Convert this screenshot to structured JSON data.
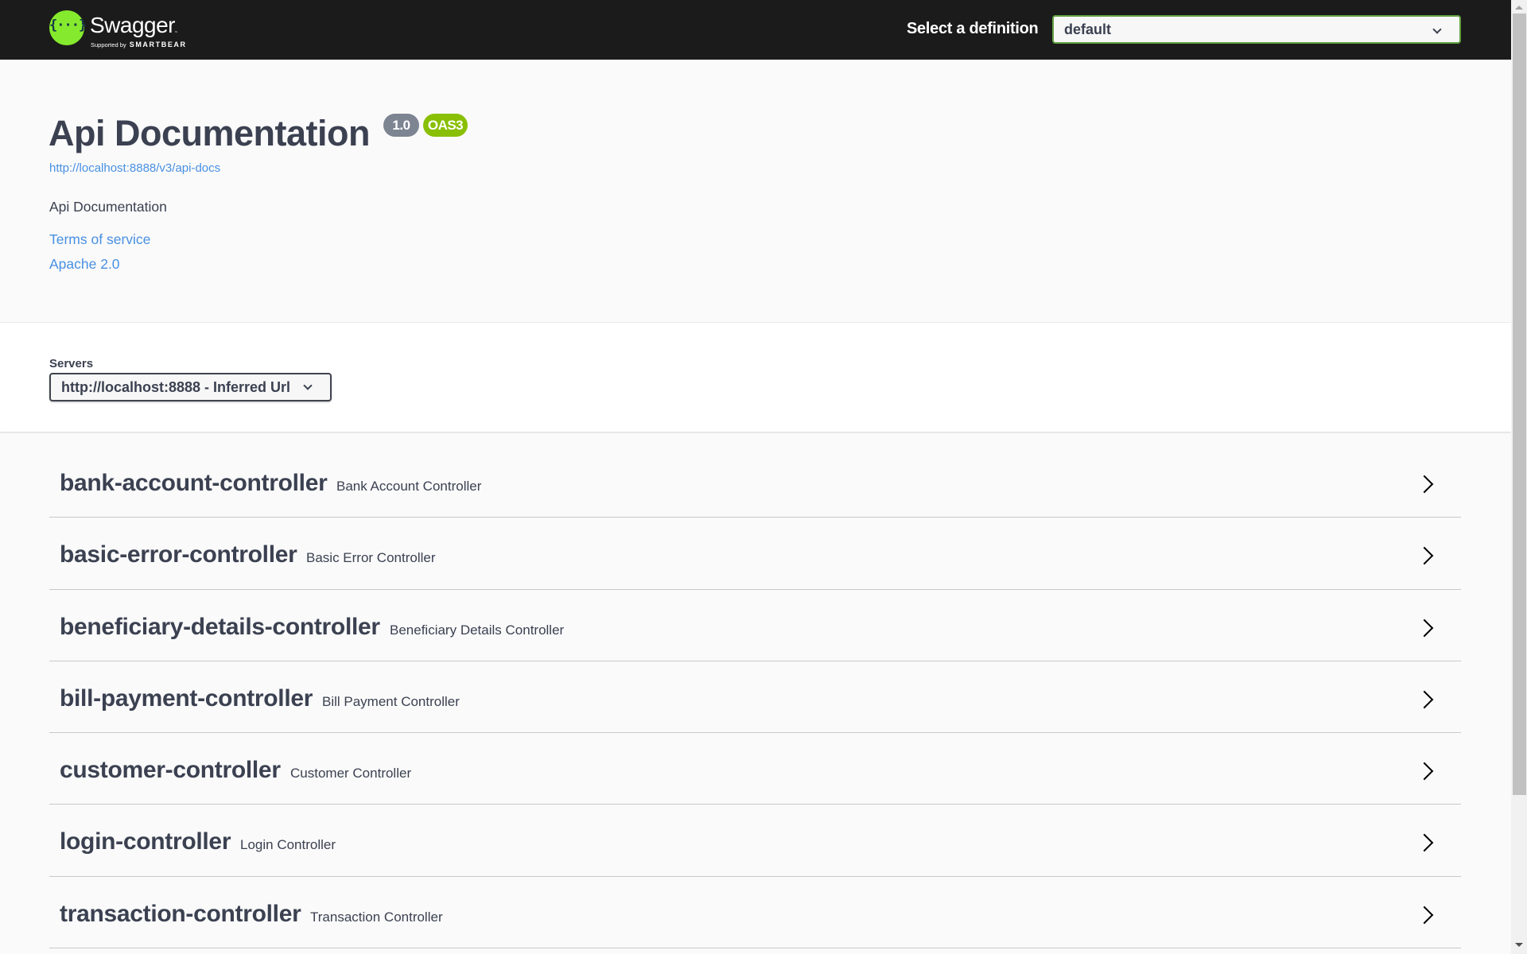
{
  "topbar": {
    "logo": {
      "icon": "swagger-braces-icon",
      "braces_glyph": "{···}",
      "name": "Swagger",
      "trademark": "™",
      "supported_by": "Supported by",
      "brand": "SMARTBEAR"
    },
    "definition_label": "Select a definition",
    "definition_selected": "default"
  },
  "info": {
    "title": "Api Documentation",
    "version_badge": "1.0",
    "spec_badge": "OAS3",
    "spec_url": "http://localhost:8888/v3/api-docs",
    "description": "Api Documentation",
    "terms_link": "Terms of service",
    "license_link": "Apache 2.0"
  },
  "servers": {
    "label": "Servers",
    "selected": "http://localhost:8888 - Inferred Url"
  },
  "tags": [
    {
      "name": "bank-account-controller",
      "description": "Bank Account Controller",
      "icon": "chevron-right-icon"
    },
    {
      "name": "basic-error-controller",
      "description": "Basic Error Controller",
      "icon": "chevron-right-icon"
    },
    {
      "name": "beneficiary-details-controller",
      "description": "Beneficiary Details Controller",
      "icon": "chevron-right-icon"
    },
    {
      "name": "bill-payment-controller",
      "description": "Bill Payment Controller",
      "icon": "chevron-right-icon"
    },
    {
      "name": "customer-controller",
      "description": "Customer Controller",
      "icon": "chevron-right-icon"
    },
    {
      "name": "login-controller",
      "description": "Login Controller",
      "icon": "chevron-right-icon"
    },
    {
      "name": "transaction-controller",
      "description": "Transaction Controller",
      "icon": "chevron-right-icon"
    }
  ],
  "colors": {
    "topbar_bg": "#1b1b1b",
    "logo_green": "#85ea2d",
    "select_border_active": "#62a03f",
    "version_badge": "#7d8492",
    "oas_badge": "#89bf04",
    "link": "#4990e2",
    "text": "#3b4151"
  }
}
